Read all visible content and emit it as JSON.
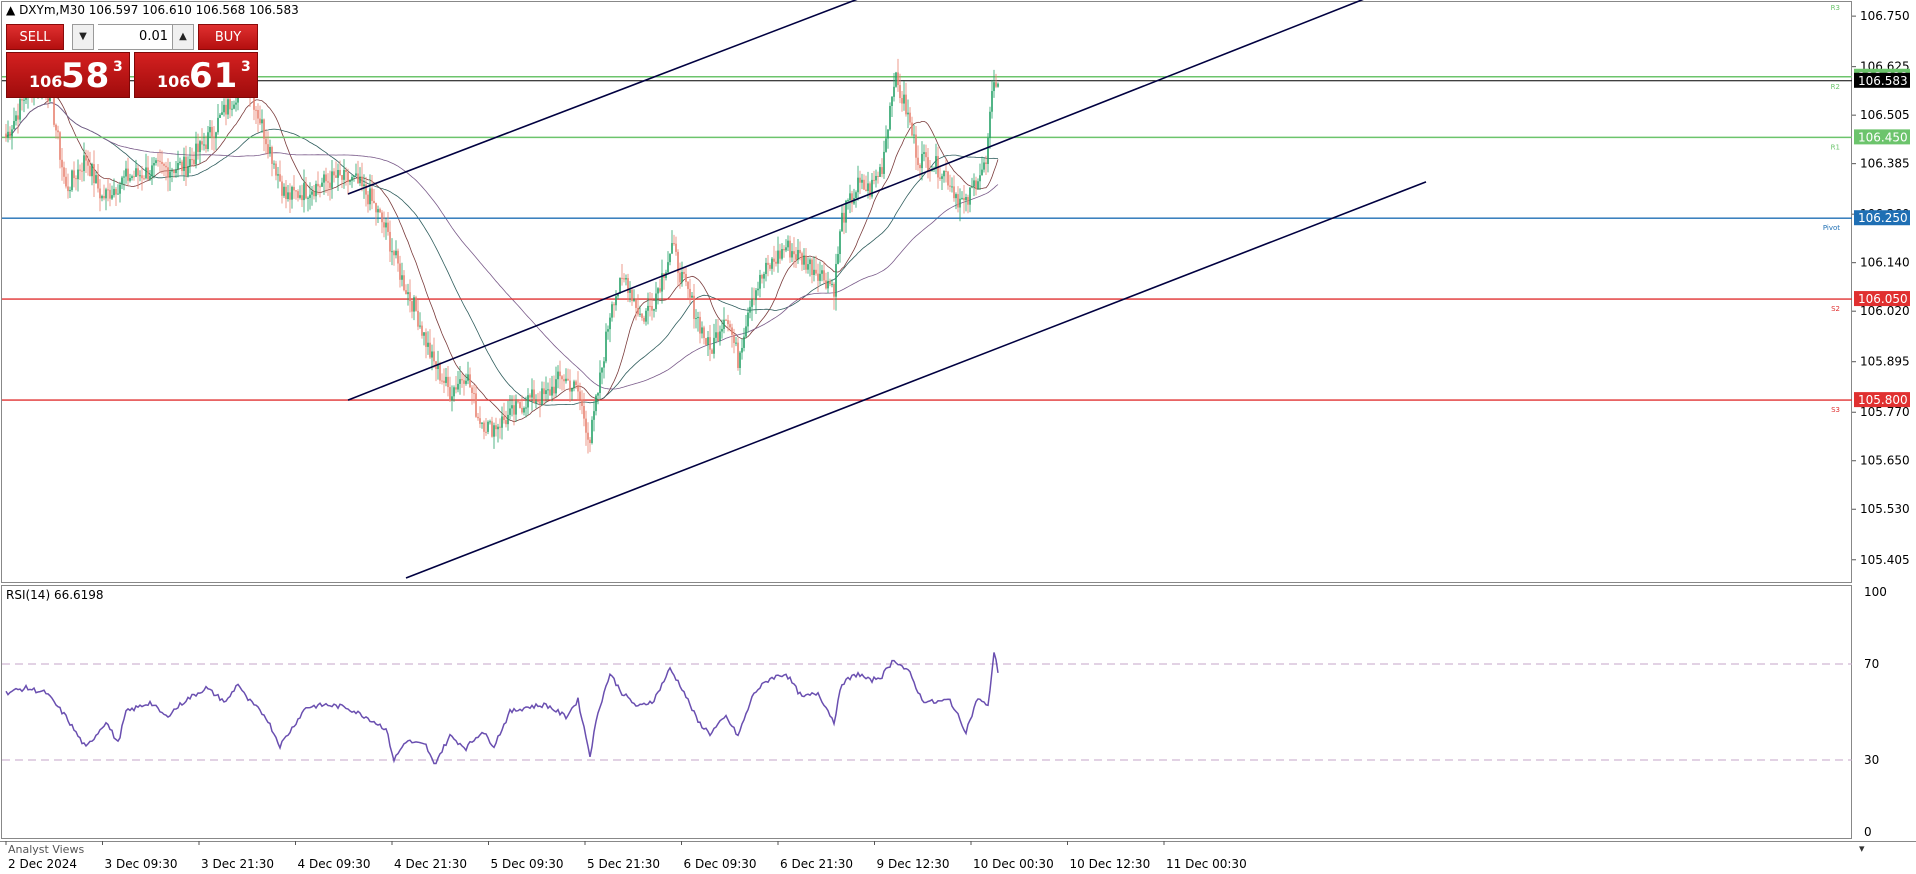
{
  "header": {
    "symbol_info": "DXYm,M30  106.597 106.610 106.568 106.583"
  },
  "trade_panel": {
    "sell_label": "SELL",
    "buy_label": "BUY",
    "lot_value": "0.01",
    "sell_price": {
      "prefix": "106",
      "big": "58",
      "sup": "3"
    },
    "buy_price": {
      "prefix": "106",
      "big": "61",
      "sup": "3"
    }
  },
  "price_axis": {
    "ticks": [
      "106.750",
      "106.625",
      "106.505",
      "106.385",
      "106.260",
      "106.140",
      "106.020",
      "105.895",
      "105.770",
      "105.650",
      "105.530",
      "105.405"
    ]
  },
  "levels": [
    {
      "value": 106.6,
      "label": "106.600",
      "pivot_label": "R2",
      "color": "#6cc46c",
      "text": "#ffffff"
    },
    {
      "value": 106.59,
      "label": "106.583",
      "pivot_label": "",
      "color": "#000000",
      "text": "#ffffff"
    },
    {
      "value": 106.45,
      "label": "106.450",
      "pivot_label": "R1",
      "color": "#6cc46c",
      "text": "#ffffff"
    },
    {
      "value": 106.25,
      "label": "106.250",
      "pivot_label": "Pivot",
      "color": "#1f6fb4",
      "text": "#ffffff"
    },
    {
      "value": 106.05,
      "label": "106.050",
      "pivot_label": "S2",
      "color": "#e03030",
      "text": "#ffffff"
    },
    {
      "value": 105.8,
      "label": "105.800",
      "pivot_label": "S3",
      "color": "#e03030",
      "text": "#ffffff"
    }
  ],
  "top_right_label": "R3",
  "time_axis": {
    "labels": [
      "2 Dec 2024",
      "3 Dec 09:30",
      "3 Dec 21:30",
      "4 Dec 09:30",
      "4 Dec 21:30",
      "5 Dec 09:30",
      "5 Dec 21:30",
      "6 Dec 09:30",
      "6 Dec 21:30",
      "9 Dec 12:30",
      "10 Dec 00:30",
      "10 Dec 12:30",
      "11 Dec 00:30"
    ]
  },
  "rsi": {
    "label": "RSI(14) 66.6198",
    "ticks": [
      "100",
      "70",
      "30",
      "0"
    ]
  },
  "footer": {
    "analyst_label": "Analyst Views"
  },
  "colors": {
    "bull": "#26a269",
    "bear": "#e8826f",
    "channel": "#000040",
    "rsi_line": "#6a4fb0"
  },
  "chart_data": {
    "type": "candlestick",
    "symbol": "DXYm",
    "timeframe": "M30",
    "ylim": [
      105.35,
      106.78
    ],
    "close_keypoints": [
      [
        0,
        106.45
      ],
      [
        12,
        106.58
      ],
      [
        22,
        106.56
      ],
      [
        30,
        106.32
      ],
      [
        40,
        106.4
      ],
      [
        48,
        106.3
      ],
      [
        60,
        106.35
      ],
      [
        75,
        106.37
      ],
      [
        90,
        106.38
      ],
      [
        100,
        106.44
      ],
      [
        110,
        106.52
      ],
      [
        120,
        106.6
      ],
      [
        130,
        106.45
      ],
      [
        140,
        106.3
      ],
      [
        150,
        106.32
      ],
      [
        165,
        106.35
      ],
      [
        175,
        106.34
      ],
      [
        182,
        106.3
      ],
      [
        190,
        106.22
      ],
      [
        198,
        106.1
      ],
      [
        205,
        106.02
      ],
      [
        213,
        105.9
      ],
      [
        222,
        105.82
      ],
      [
        230,
        105.87
      ],
      [
        236,
        105.76
      ],
      [
        242,
        105.73
      ],
      [
        252,
        105.76
      ],
      [
        260,
        105.8
      ],
      [
        270,
        105.81
      ],
      [
        278,
        105.86
      ],
      [
        286,
        105.82
      ],
      [
        292,
        105.7
      ],
      [
        297,
        105.85
      ],
      [
        303,
        106.05
      ],
      [
        310,
        106.1
      ],
      [
        318,
        106.0
      ],
      [
        324,
        106.05
      ],
      [
        333,
        106.18
      ],
      [
        338,
        106.1
      ],
      [
        346,
        106.0
      ],
      [
        352,
        105.92
      ],
      [
        360,
        106.02
      ],
      [
        366,
        105.9
      ],
      [
        372,
        106.05
      ],
      [
        380,
        106.12
      ],
      [
        390,
        106.18
      ],
      [
        398,
        106.15
      ],
      [
        406,
        106.12
      ],
      [
        414,
        106.08
      ],
      [
        418,
        106.25
      ],
      [
        426,
        106.33
      ],
      [
        432,
        106.32
      ],
      [
        438,
        106.38
      ],
      [
        444,
        106.6
      ],
      [
        450,
        106.52
      ],
      [
        456,
        106.4
      ],
      [
        462,
        106.39
      ],
      [
        470,
        106.36
      ],
      [
        476,
        106.3
      ],
      [
        480,
        106.28
      ],
      [
        486,
        106.36
      ],
      [
        490,
        106.38
      ],
      [
        494,
        106.6
      ],
      [
        496,
        106.583
      ]
    ],
    "rsi_keypoints": [
      [
        0,
        58
      ],
      [
        10,
        60
      ],
      [
        20,
        58
      ],
      [
        30,
        48
      ],
      [
        36,
        40
      ],
      [
        40,
        35
      ],
      [
        50,
        46
      ],
      [
        56,
        37
      ],
      [
        60,
        50
      ],
      [
        72,
        54
      ],
      [
        80,
        48
      ],
      [
        90,
        55
      ],
      [
        100,
        60
      ],
      [
        110,
        54
      ],
      [
        116,
        62
      ],
      [
        120,
        56
      ],
      [
        130,
        48
      ],
      [
        137,
        36
      ],
      [
        142,
        42
      ],
      [
        150,
        52
      ],
      [
        160,
        53
      ],
      [
        170,
        52
      ],
      [
        180,
        48
      ],
      [
        190,
        43
      ],
      [
        194,
        30
      ],
      [
        200,
        38
      ],
      [
        210,
        36
      ],
      [
        214,
        28
      ],
      [
        222,
        40
      ],
      [
        230,
        35
      ],
      [
        238,
        42
      ],
      [
        244,
        36
      ],
      [
        252,
        50
      ],
      [
        260,
        52
      ],
      [
        270,
        53
      ],
      [
        280,
        48
      ],
      [
        286,
        55
      ],
      [
        292,
        32
      ],
      [
        296,
        50
      ],
      [
        302,
        66
      ],
      [
        308,
        58
      ],
      [
        316,
        52
      ],
      [
        324,
        55
      ],
      [
        332,
        68
      ],
      [
        338,
        60
      ],
      [
        346,
        46
      ],
      [
        352,
        41
      ],
      [
        360,
        48
      ],
      [
        366,
        40
      ],
      [
        374,
        58
      ],
      [
        382,
        64
      ],
      [
        390,
        66
      ],
      [
        398,
        56
      ],
      [
        406,
        58
      ],
      [
        414,
        46
      ],
      [
        418,
        62
      ],
      [
        426,
        66
      ],
      [
        432,
        63
      ],
      [
        438,
        65
      ],
      [
        444,
        72
      ],
      [
        452,
        66
      ],
      [
        458,
        55
      ],
      [
        464,
        54
      ],
      [
        472,
        55
      ],
      [
        478,
        45
      ],
      [
        480,
        42
      ],
      [
        486,
        56
      ],
      [
        491,
        52
      ],
      [
        494,
        75
      ],
      [
        496,
        67
      ]
    ],
    "channels": [
      {
        "points": [
          [
            171,
            106.31
          ],
          [
            430,
            106.8
          ]
        ]
      },
      {
        "points": [
          [
            171,
            105.8
          ],
          [
            683,
            106.8
          ]
        ]
      },
      {
        "points": [
          [
            200,
            105.36
          ],
          [
            710,
            106.34
          ]
        ]
      }
    ],
    "rsi_levels": [
      70,
      30
    ]
  }
}
